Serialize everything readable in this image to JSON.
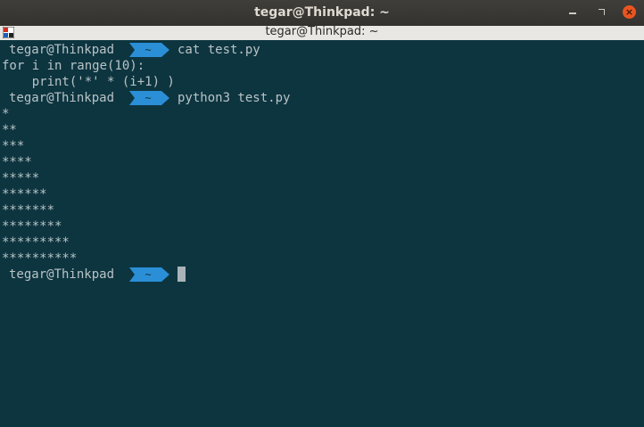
{
  "window": {
    "title": "tegar@Thinkpad: ~",
    "tab_title": "tegar@Thinkpad: ~",
    "minimize_symbol": "",
    "maximize_symbol": "",
    "close_symbol": "×"
  },
  "prompt": {
    "user_host": "tegar@Thinkpad",
    "dir": "~",
    "accent_color": "#2a8fd6"
  },
  "terminal": {
    "lines": [
      {
        "kind": "prompt",
        "command": "cat test.py"
      },
      {
        "kind": "output",
        "text": "for i in range(10):"
      },
      {
        "kind": "output",
        "text": "    print('*' * (i+1) )"
      },
      {
        "kind": "prompt",
        "command": "python3 test.py"
      },
      {
        "kind": "output",
        "text": "*"
      },
      {
        "kind": "output",
        "text": "**"
      },
      {
        "kind": "output",
        "text": "***"
      },
      {
        "kind": "output",
        "text": "****"
      },
      {
        "kind": "output",
        "text": "*****"
      },
      {
        "kind": "output",
        "text": "******"
      },
      {
        "kind": "output",
        "text": "*******"
      },
      {
        "kind": "output",
        "text": "********"
      },
      {
        "kind": "output",
        "text": "*********"
      },
      {
        "kind": "output",
        "text": "**********"
      },
      {
        "kind": "prompt",
        "command": ""
      }
    ]
  },
  "colors": {
    "background": "#0d3540",
    "foreground": "#b9c3c6",
    "close_button": "#e95420"
  }
}
